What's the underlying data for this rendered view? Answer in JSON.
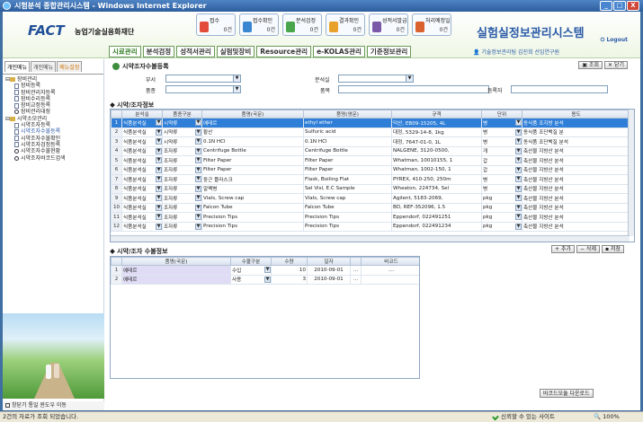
{
  "window": {
    "title": "시험분석 종합관리시스템 - Windows Internet Explorer",
    "min": "_",
    "max": "□",
    "close": "X"
  },
  "header": {
    "logo": "FACT",
    "logo_sub": "농업기술실용화재단",
    "quick": [
      {
        "label": "접수",
        "count": "0건",
        "color": "#e34b3b"
      },
      {
        "label": "접수확인",
        "count": "0건",
        "color": "#3a86d0"
      },
      {
        "label": "분석검정",
        "count": "0건",
        "color": "#49a64c"
      },
      {
        "label": "결과확인",
        "count": "0건",
        "color": "#e8a12b"
      },
      {
        "label": "성적서발급",
        "count": "0건",
        "color": "#7a5aa8"
      },
      {
        "label": "처리예정일",
        "count": "0건",
        "color": "#d9622e"
      }
    ],
    "system_title": "실험실정보관리시스템",
    "logout": "Logout",
    "user_info": "기술정보관리팀 김진희 선임연구원",
    "gnb": [
      "시료관리",
      "분석검정",
      "성적서관리",
      "실험및장비",
      "Resource관리",
      "e-KOLAS관리",
      "기준정보관리"
    ]
  },
  "left": {
    "tabs": [
      "개인메뉴",
      "개인메뉴",
      "메뉴설정"
    ],
    "tree": [
      {
        "type": "f",
        "label": "장비관리"
      },
      {
        "type": "i",
        "label": "장비등록"
      },
      {
        "type": "i",
        "label": "장비관리자등록"
      },
      {
        "type": "i",
        "label": "장비수리등록"
      },
      {
        "type": "i",
        "label": "장비교정등록"
      },
      {
        "type": "s",
        "label": "장비관리대장"
      },
      {
        "type": "f",
        "label": "시약소모관리"
      },
      {
        "type": "i",
        "label": "시약조자등록"
      },
      {
        "type": "sel",
        "label": "시약조자수불등록"
      },
      {
        "type": "i",
        "label": "시약조자수불확인"
      },
      {
        "type": "i",
        "label": "시약조자검정등록"
      },
      {
        "type": "s",
        "label": "시약조자수불현황"
      },
      {
        "type": "s",
        "label": "시약조자바코드검색"
      }
    ],
    "footer": "창닫기 통일 윈도우 이동"
  },
  "main": {
    "page_title": "시약조자수불등록",
    "btn_search": "조회",
    "btn_close": "닫기",
    "search": {
      "dept_label": "부서",
      "lab_label": "분석실",
      "type_label": "품종",
      "name_label": "품목",
      "reg_label": "등록자"
    },
    "section1": "시약/조자정보",
    "section2": "시약/조자 수불정보",
    "btn_add": "추가",
    "btn_del": "삭제",
    "btn_save": "저장",
    "btn_barcode": "바코드모듈 다운로드",
    "grid1": {
      "headers": [
        "",
        "분석실",
        "품종구분",
        "품명(국문)",
        "품명(영문)",
        "규격",
        "단위",
        "용도"
      ],
      "rows": [
        [
          "1",
          "식품분석실",
          "시약류",
          "에테르",
          "ethyl ether",
          "덕산, EB09-15205, 4L",
          "병",
          "동식품 조지방 분석"
        ],
        [
          "2",
          "식품분석실",
          "시약류",
          "황산",
          "Sulfuric acid",
          "대정, 5329-14-8, 1kg",
          "병",
          "동식품 조단백질 분"
        ],
        [
          "3",
          "식품분석실",
          "시약류",
          "0.1N HCl",
          "0.1N HCl",
          "대정, 7647-01-0, 1L",
          "병",
          "동식품 조단백질 분석"
        ],
        [
          "4",
          "식품분석실",
          "조자류",
          "Centrifuge Bottle",
          "Centrifuge Bottle",
          "NALGENE, 3120-0500,",
          "개",
          "축산물 지방산 분석"
        ],
        [
          "5",
          "식품분석실",
          "조자류",
          "Filter Paper",
          "Filter Paper",
          "Whatman, 10010155, 1",
          "갑",
          "축산물 지방산 분석"
        ],
        [
          "6",
          "식품분석실",
          "조자류",
          "Filter Paper",
          "Filter Paper",
          "Whatman, 1002-150, 1",
          "갑",
          "축산물 지방산 분석"
        ],
        [
          "7",
          "식품분석실",
          "조자류",
          "둥근 플라스크",
          "Flask, Boiling Flat",
          "PYREX, 410-250, 250m",
          "병",
          "축산물 지방산 분석"
        ],
        [
          "8",
          "식품분석실",
          "조자류",
          "알팩병",
          "Sel Visl, E.C Sample",
          "Wheaton, 224734, Sel",
          "병",
          "축산물 지방산 분석"
        ],
        [
          "9",
          "식품분석실",
          "조자류",
          "Vials, Screw cap",
          "Vials, Screw cap",
          "Agilent, 5183-2069,",
          "pkg",
          "축산물 지방산 분석"
        ],
        [
          "10",
          "식품분석실",
          "조자류",
          "Falcon Tube",
          "Falcon Tube",
          "BD, REF-352096, 1.5",
          "pkg",
          "축산물 지방산 분석"
        ],
        [
          "11",
          "식품분석실",
          "조자류",
          "Precision Tips",
          "Precision Tips",
          "Eppendorf, 022491251",
          "pkg",
          "축산물 지방산 분석"
        ],
        [
          "12",
          "식품분석실",
          "조자류",
          "Precision Tips",
          "Precision Tips",
          "Eppendorf, 022491234",
          "pkg",
          "축산물 지방산 분석"
        ]
      ]
    },
    "grid2": {
      "headers": [
        "",
        "품명(국문)",
        "수불구분",
        "수량",
        "일자",
        "",
        "바코드"
      ],
      "rows": [
        [
          "1",
          "에테르",
          "수입",
          "10",
          "2010-09-01",
          "...",
          "...."
        ],
        [
          "2",
          "에테르",
          "사용",
          "3",
          "2010-09-01",
          "...",
          ""
        ]
      ]
    }
  },
  "status": {
    "left": "2건의 자료가 조회 되었습니다.",
    "zone": "신뢰할 수 있는 사이트",
    "zoom": "100%"
  }
}
